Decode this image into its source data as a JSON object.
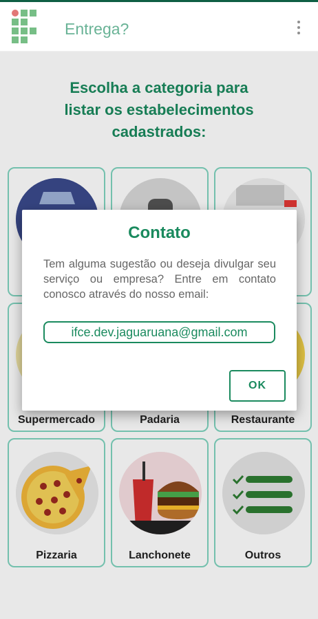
{
  "app": {
    "title": "Entrega?",
    "logo_icon": "ifce-logo-icon",
    "menu_icon": "more-vert-icon"
  },
  "heading": {
    "line1": "Escolha a categoria para",
    "line2": "listar os estabelecimentos",
    "line3": "cadastrados:"
  },
  "categories": [
    {
      "label": "Supermercado",
      "icon": "supermarket-icon"
    },
    {
      "label": "Padaria",
      "icon": "bakery-icon"
    },
    {
      "label": "Restaurante",
      "icon": "restaurant-icon"
    },
    {
      "label": "Pizzaria",
      "icon": "pizza-icon"
    },
    {
      "label": "Lanchonete",
      "icon": "burger-drink-icon"
    },
    {
      "label": "Outros",
      "icon": "checklist-icon"
    }
  ],
  "dialog": {
    "title": "Contato",
    "message": "Tem alguma sugestão ou deseja divulgar seu serviço ou empresa? Entre em contato conosco através do nosso email:",
    "email": "ifce.dev.jaguaruana@gmail.com",
    "ok_label": "OK"
  },
  "colors": {
    "primary": "#1a8a5e",
    "card_border": "#7fd4bf",
    "status_bar": "#0f5f44"
  }
}
